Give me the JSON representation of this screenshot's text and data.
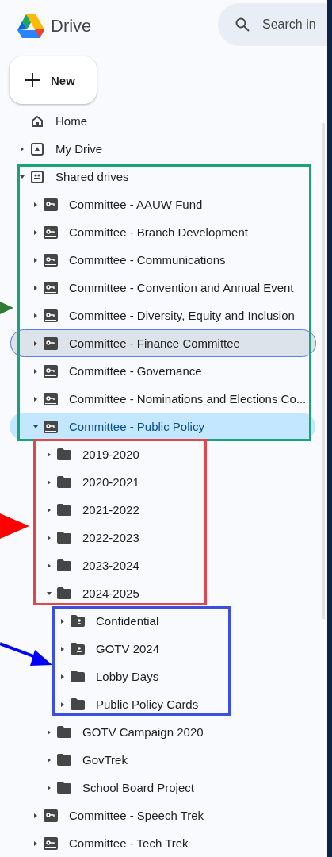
{
  "header": {
    "app_name": "Drive",
    "search": {
      "placeholder": "Search in"
    }
  },
  "new_button": {
    "label": "New"
  },
  "nav": [
    {
      "kind": "home",
      "label": "Home",
      "selected": false,
      "hovered": false
    },
    {
      "kind": "mydrive",
      "label": "My Drive",
      "expanded": false,
      "selected": false,
      "hovered": false
    },
    {
      "kind": "shared",
      "label": "Shared drives",
      "expanded": true,
      "selected": false,
      "hovered": false,
      "children": [
        {
          "kind": "drive",
          "label": "Committee - AAUW Fund",
          "expanded": false,
          "selected": false,
          "hovered": false
        },
        {
          "kind": "drive",
          "label": "Committee - Branch Development",
          "expanded": false,
          "selected": false,
          "hovered": false
        },
        {
          "kind": "drive",
          "label": "Committee - Communications",
          "expanded": false,
          "selected": false,
          "hovered": false
        },
        {
          "kind": "drive",
          "label": "Committee - Convention and Annual Event",
          "expanded": false,
          "selected": false,
          "hovered": false
        },
        {
          "kind": "drive",
          "label": "Committee - Diversity, Equity and Inclusion",
          "expanded": false,
          "selected": false,
          "hovered": false
        },
        {
          "kind": "drive",
          "label": "Committee - Finance Committee",
          "expanded": false,
          "selected": false,
          "hovered": true
        },
        {
          "kind": "drive",
          "label": "Committee - Governance",
          "expanded": false,
          "selected": false,
          "hovered": false
        },
        {
          "kind": "drive",
          "label": "Committee - Nominations and Elections Co...",
          "expanded": false,
          "selected": false,
          "hovered": false
        },
        {
          "kind": "drive",
          "label": "Committee - Public Policy",
          "expanded": true,
          "selected": true,
          "hovered": false,
          "children": [
            {
              "kind": "folder",
              "label": "2019-2020",
              "expanded": false,
              "selected": false,
              "hovered": false
            },
            {
              "kind": "folder",
              "label": "2020-2021",
              "expanded": false,
              "selected": false,
              "hovered": false
            },
            {
              "kind": "folder",
              "label": "2021-2022",
              "expanded": false,
              "selected": false,
              "hovered": false
            },
            {
              "kind": "folder",
              "label": "2022-2023",
              "expanded": false,
              "selected": false,
              "hovered": false
            },
            {
              "kind": "folder",
              "label": "2023-2024",
              "expanded": false,
              "selected": false,
              "hovered": false
            },
            {
              "kind": "folder",
              "label": "2024-2025",
              "expanded": true,
              "selected": false,
              "hovered": false,
              "children": [
                {
                  "kind": "shared_folder",
                  "label": "Confidential",
                  "expanded": false,
                  "selected": false,
                  "hovered": false
                },
                {
                  "kind": "shared_folder",
                  "label": "GOTV 2024",
                  "expanded": false,
                  "selected": false,
                  "hovered": false
                },
                {
                  "kind": "folder",
                  "label": "Lobby Days",
                  "expanded": false,
                  "selected": false,
                  "hovered": false
                },
                {
                  "kind": "folder",
                  "label": "Public Policy Cards",
                  "expanded": false,
                  "selected": false,
                  "hovered": false
                }
              ]
            },
            {
              "kind": "folder",
              "label": "GOTV Campaign 2020",
              "expanded": false,
              "selected": false,
              "hovered": false
            },
            {
              "kind": "folder",
              "label": "GovTrek",
              "expanded": false,
              "selected": false,
              "hovered": false
            },
            {
              "kind": "folder",
              "label": "School Board Project",
              "expanded": false,
              "selected": false,
              "hovered": false
            }
          ]
        },
        {
          "kind": "drive",
          "label": "Committee - Speech Trek",
          "expanded": false,
          "selected": false,
          "hovered": false
        },
        {
          "kind": "drive",
          "label": "Committee - Tech Trek",
          "expanded": false,
          "selected": false,
          "hovered": false
        }
      ]
    }
  ]
}
